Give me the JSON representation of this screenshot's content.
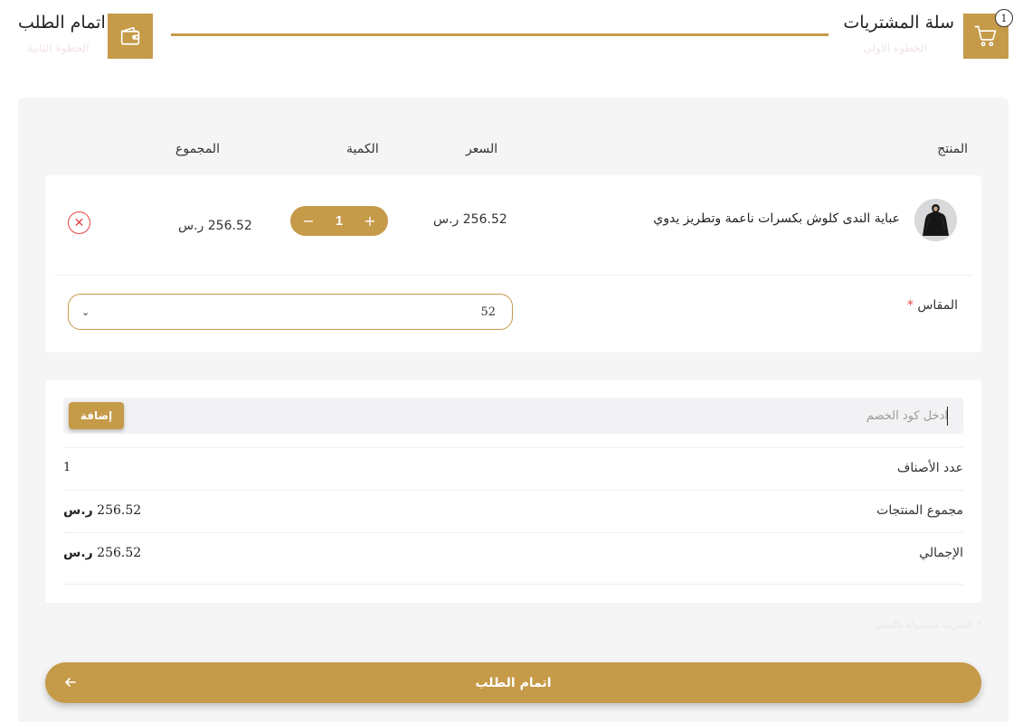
{
  "stepper": {
    "cart_title": "سلة المشتريات",
    "cart_subtitle": "الخطوة الاولى",
    "cart_count": "1",
    "checkout_title": "اتمام الطلب",
    "checkout_subtitle": "الخطوة الثانية",
    "cart_icon": "cart-icon",
    "wallet_icon": "wallet-icon"
  },
  "table": {
    "headers": {
      "product": "المنتج",
      "price": "السعر",
      "quantity": "الكمية",
      "total": "المجموع"
    }
  },
  "cart_items": [
    {
      "name": "عباية الندى كلوش بكسرات ناعمة وتطريز يدوي",
      "price": "256.52 ر.س",
      "quantity": "1",
      "total": "256.52 ر.س",
      "size_label": "المقاس",
      "size_required_mark": "*",
      "size_value": "52"
    }
  ],
  "coupon": {
    "placeholder": "ادخل كود الخصم",
    "add_label": "إضافة"
  },
  "summary": {
    "items_count_label": "عدد الأصناف",
    "items_count_value": "1",
    "subtotal_label": "مجموع المنتجات",
    "subtotal_amount": "256.52",
    "subtotal_currency": "ر.س",
    "grand_total_label": "الإجمالي",
    "grand_total_amount": "256.52",
    "grand_total_currency": "ر.س"
  },
  "note": "* الضريبة مشمولة بالسعر",
  "checkout_button": {
    "label": "اتمام الطلب"
  },
  "colors": {
    "accent": "#c59a48",
    "danger": "#e64545",
    "panel_bg": "#f5f5f6"
  }
}
